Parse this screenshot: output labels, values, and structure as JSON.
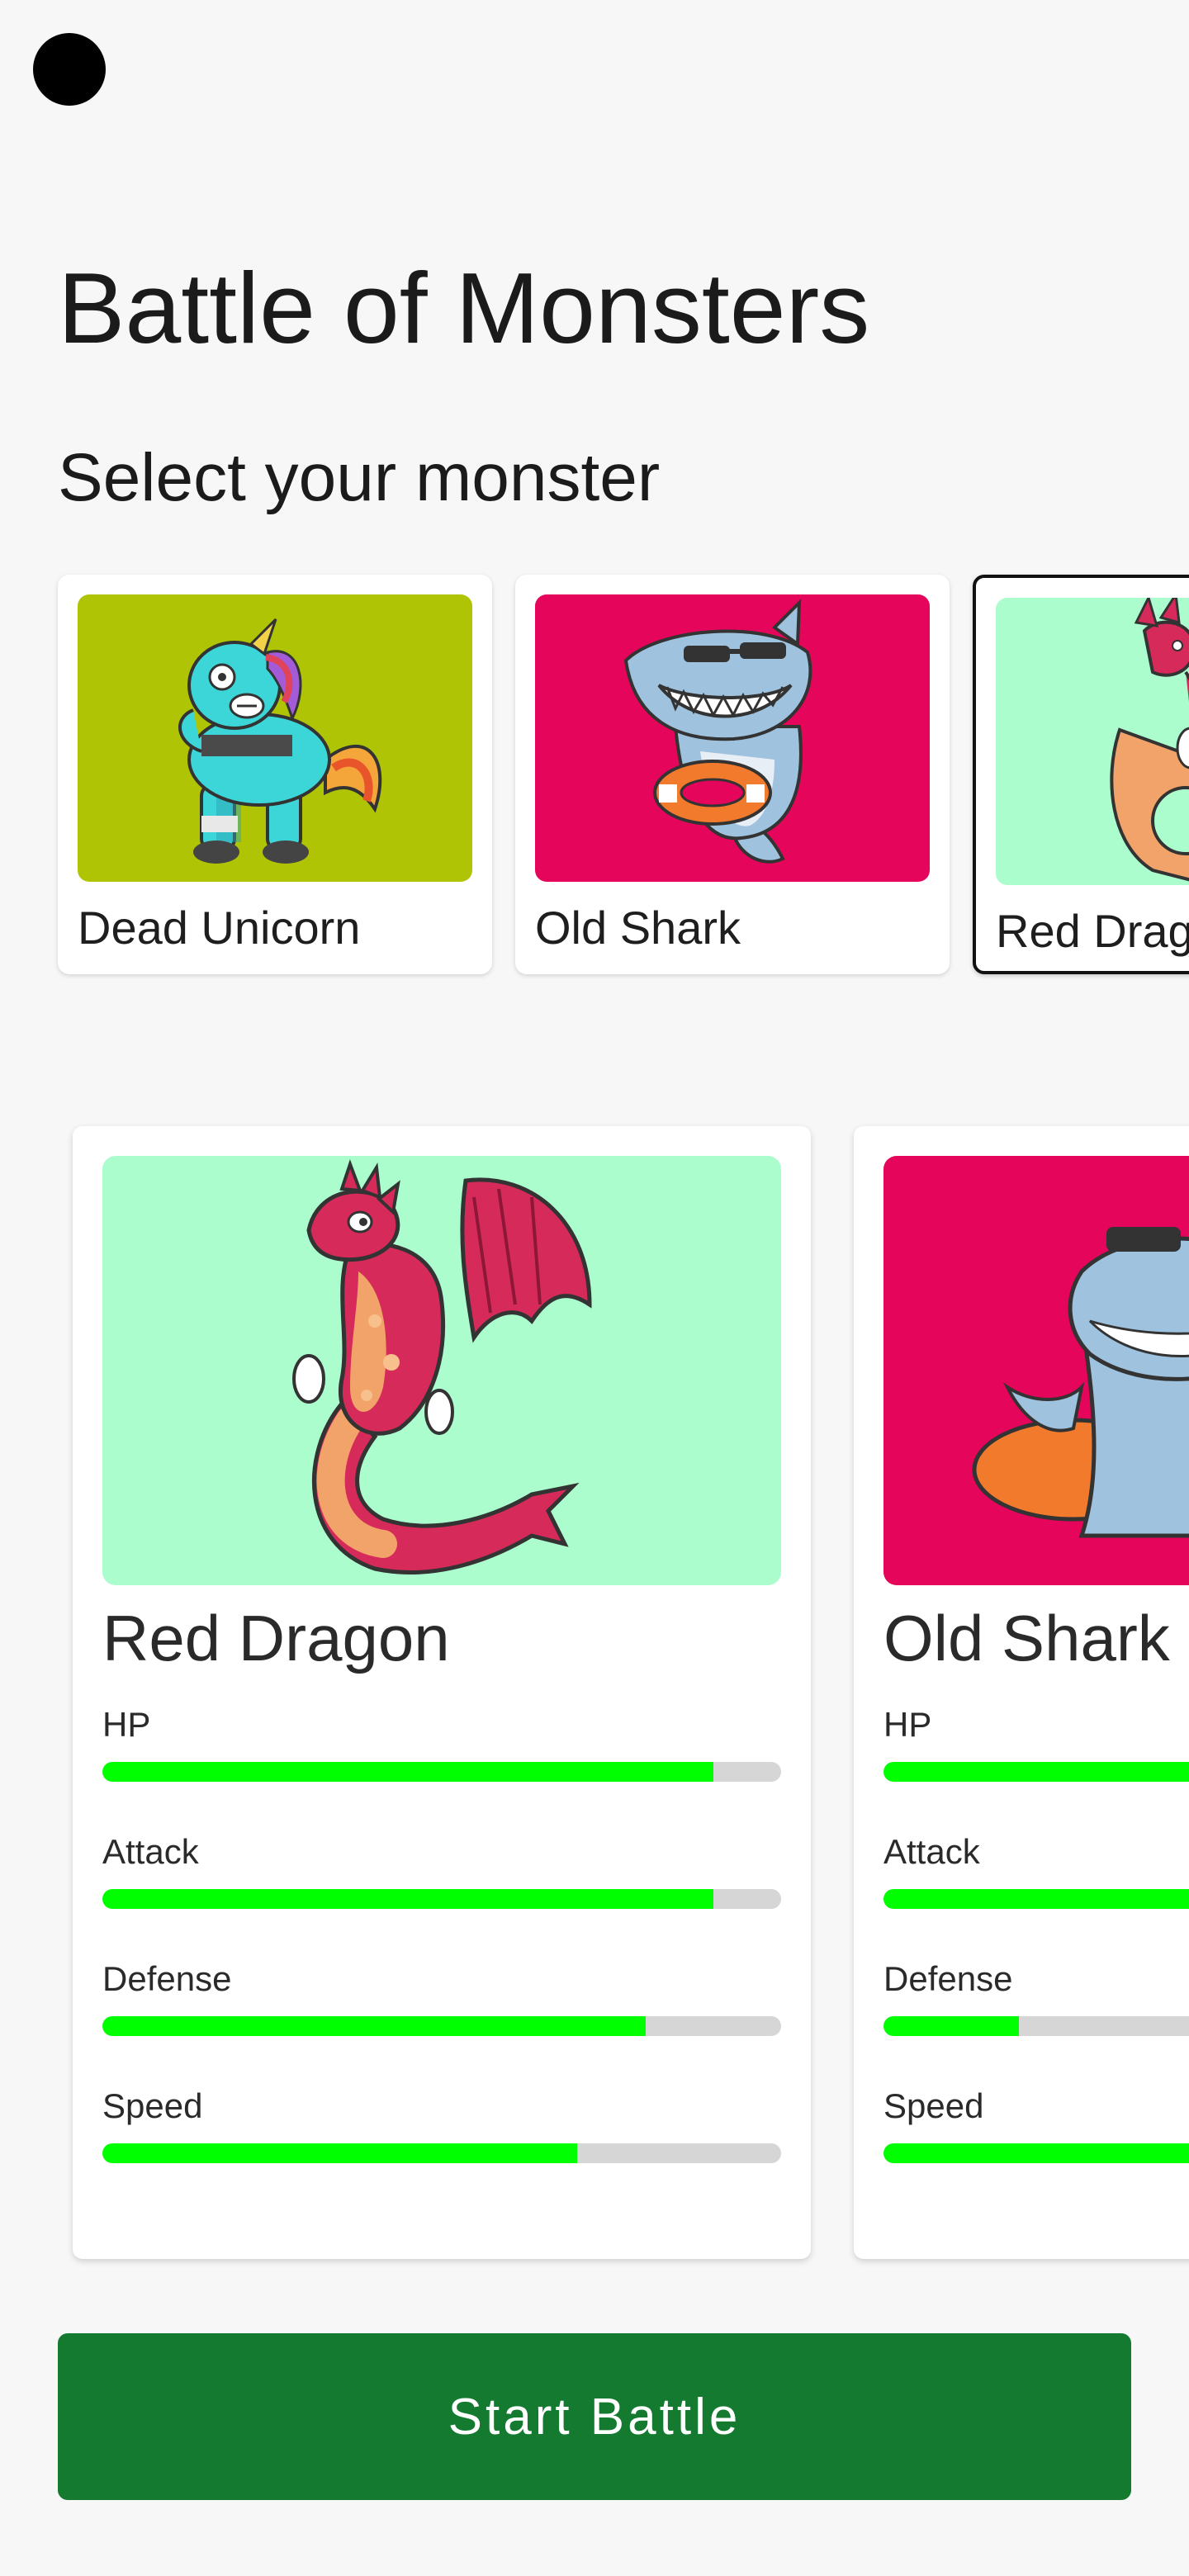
{
  "app": {
    "title": "Battle of Monsters",
    "subtitle": "Select your monster"
  },
  "selector": {
    "cards": [
      {
        "name": "Dead Unicorn",
        "image_icon": "dead-unicorn-image",
        "bg": "#b0c406",
        "selected": false
      },
      {
        "name": "Old Shark",
        "image_icon": "old-shark-image",
        "bg": "#e5055a",
        "selected": false
      },
      {
        "name": "Red Drago",
        "image_icon": "red-dragon-image",
        "bg": "#abfdce",
        "selected": true
      }
    ]
  },
  "player": {
    "name": "Red Dragon",
    "image_icon": "red-dragon-image",
    "bg": "#abfdce",
    "stats": [
      {
        "label": "HP",
        "value": 0.9
      },
      {
        "label": "Attack",
        "value": 0.9
      },
      {
        "label": "Defense",
        "value": 0.8
      },
      {
        "label": "Speed",
        "value": 0.7
      }
    ]
  },
  "opponent": {
    "name": "Old Shark",
    "image_icon": "old-shark-image",
    "bg": "#e5055a",
    "stats": [
      {
        "label": "HP",
        "value": 1.0
      },
      {
        "label": "Attack",
        "value": 1.0
      },
      {
        "label": "Defense",
        "value": 0.2
      },
      {
        "label": "Speed",
        "value": 1.0
      }
    ]
  },
  "actions": {
    "start_battle": "Start Battle"
  },
  "colors": {
    "bar_fill": "#00ff00",
    "bar_track": "#d6d6d6",
    "button": "#137a2f"
  }
}
